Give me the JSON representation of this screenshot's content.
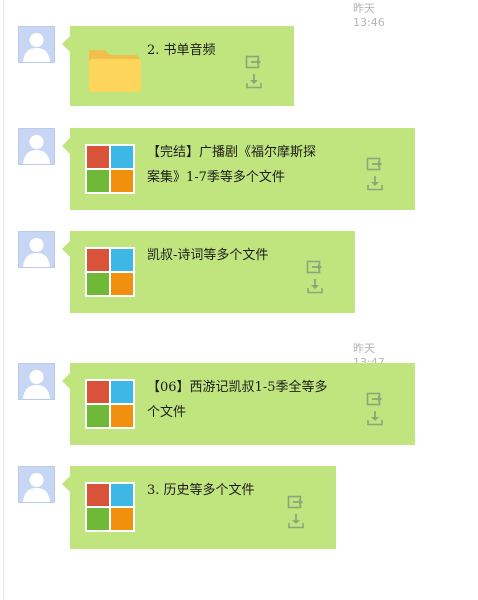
{
  "timestamps": [
    "昨天 13:46",
    "昨天 13:47"
  ],
  "colors": {
    "bubble": "#c0e57e",
    "avatar": "#c7d6f4",
    "icon_gray": "#8ea57a"
  },
  "messages": [
    {
      "icon": "folder-icon",
      "name": "2. 书单音频"
    },
    {
      "icon": "multi-file-icon",
      "name_lines": [
        "【完结】广播剧《福尔摩斯探",
        "案集》1-7季等多个文件"
      ]
    },
    {
      "icon": "multi-file-icon",
      "name": "凯叔-诗词等多个文件"
    },
    {
      "icon": "multi-file-icon",
      "name_lines": [
        "【06】西游记凯叔1-5季全等多",
        "个文件"
      ]
    },
    {
      "icon": "multi-file-icon",
      "name": "3. 历史等多个文件"
    }
  ],
  "action_icons": [
    "forward-icon",
    "download-icon"
  ]
}
